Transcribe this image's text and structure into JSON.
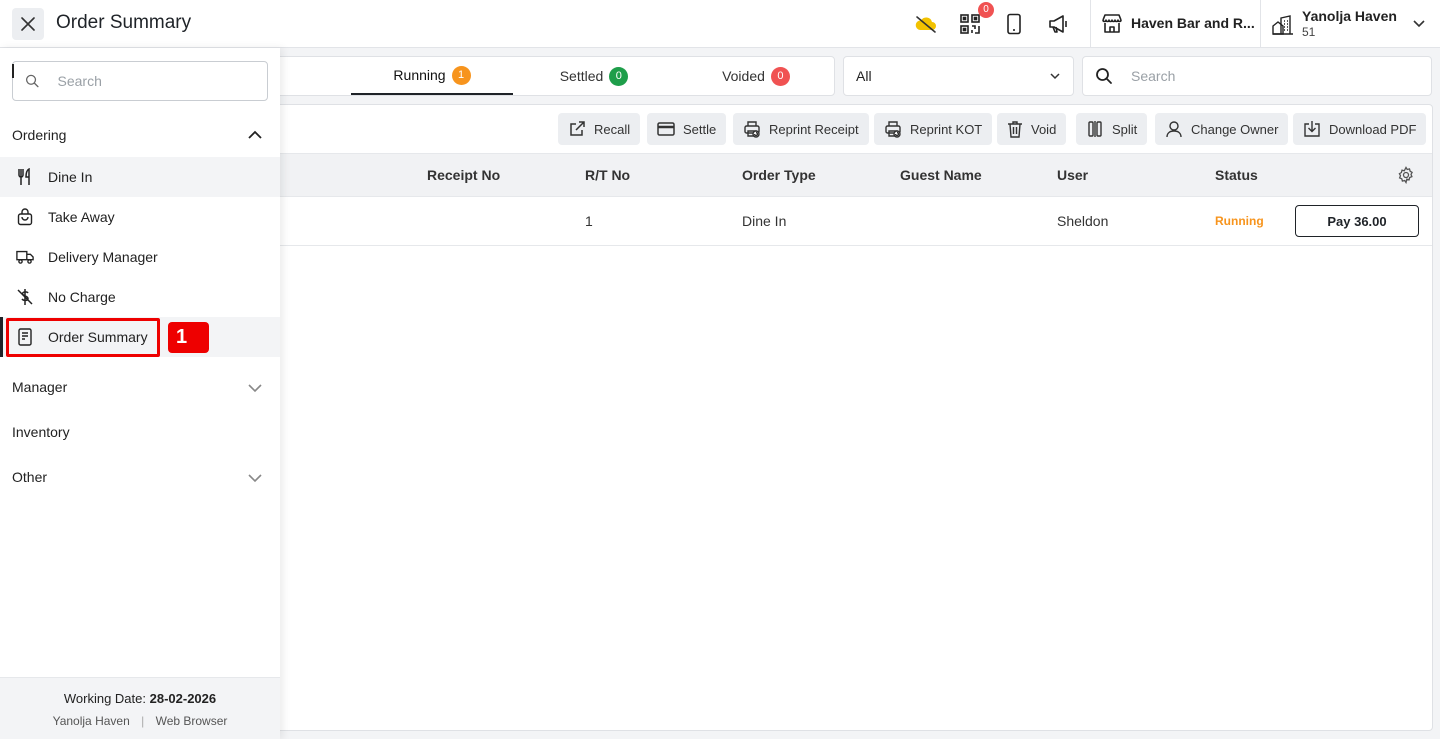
{
  "header": {
    "title": "Order Summary",
    "icons": [
      "close-icon",
      "cloud-off-icon",
      "qr-code-icon",
      "tablet-icon",
      "megaphone-icon",
      "store-icon",
      "building-icon",
      "chevron-down-icon"
    ],
    "qr_badge": "0",
    "outlet_name": "Haven Bar and R...",
    "property_name": "Yanolja Haven",
    "property_id": "51"
  },
  "tabs": [
    {
      "label": "Running",
      "count": "1",
      "color": "#f7941d"
    },
    {
      "label": "Settled",
      "count": "0",
      "color": "#1e9e4a"
    },
    {
      "label": "Voided",
      "count": "0",
      "color": "#f05252"
    }
  ],
  "filter": {
    "selected": "All"
  },
  "search": {
    "placeholder": "Search"
  },
  "toolbar": [
    {
      "label": "Recall",
      "icon": "external-link-icon"
    },
    {
      "label": "Settle",
      "icon": "card-icon"
    },
    {
      "label": "Reprint Receipt",
      "icon": "printer-icon"
    },
    {
      "label": "Reprint KOT",
      "icon": "printer-icon"
    },
    {
      "label": "Void",
      "icon": "trash-icon"
    },
    {
      "label": "Split",
      "icon": "split-icon"
    },
    {
      "label": "Change Owner",
      "icon": "user-icon"
    },
    {
      "label": "Download PDF",
      "icon": "download-icon"
    }
  ],
  "table": {
    "columns": [
      "Receipt No",
      "R/T No",
      "Order Type",
      "Guest Name",
      "User",
      "Status"
    ],
    "rows": [
      {
        "receipt_no": "",
        "rt_no": "1",
        "order_type": "Dine In",
        "guest_name": "",
        "user": "Sheldon",
        "status": "Running",
        "action": "Pay 36.00"
      }
    ]
  },
  "sidebar": {
    "search_placeholder": "Search",
    "sections": {
      "ordering": "Ordering",
      "manager": "Manager",
      "inventory": "Inventory",
      "other": "Other"
    },
    "items": [
      {
        "label": "Dine In",
        "icon": "utensils-icon"
      },
      {
        "label": "Take Away",
        "icon": "shopping-bag-icon"
      },
      {
        "label": "Delivery Manager",
        "icon": "truck-icon"
      },
      {
        "label": "No Charge",
        "icon": "no-dollar-icon"
      },
      {
        "label": "Order Summary",
        "icon": "receipt-icon"
      }
    ],
    "step_badge": "1",
    "footer": {
      "working_date_label": "Working Date:",
      "working_date": "28-02-2026",
      "property": "Yanolja Haven",
      "separator": "|",
      "device": "Web Browser"
    }
  },
  "colors": {
    "accent": "#1f2328",
    "running": "#f7941d",
    "highlight": "#ee0000"
  }
}
